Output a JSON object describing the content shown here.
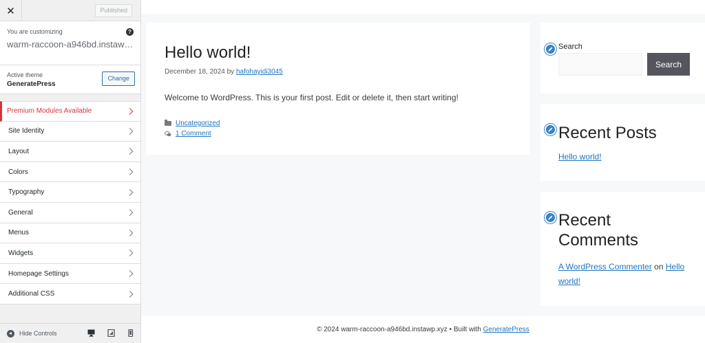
{
  "customizer": {
    "close_icon": "close-icon",
    "publish_label": "Published",
    "customizing_label": "You are customizing",
    "site_name": "warm-raccoon-a946bd.instawp.xyz",
    "active_theme_label": "Active theme",
    "theme_name": "GeneratePress",
    "change_label": "Change",
    "menu": [
      {
        "label": "Premium Modules Available"
      },
      {
        "label": "Site Identity"
      },
      {
        "label": "Layout"
      },
      {
        "label": "Colors"
      },
      {
        "label": "Typography"
      },
      {
        "label": "General"
      },
      {
        "label": "Menus"
      },
      {
        "label": "Widgets"
      },
      {
        "label": "Homepage Settings"
      },
      {
        "label": "Additional CSS"
      }
    ],
    "hide_controls_label": "Hide Controls"
  },
  "post": {
    "title": "Hello world!",
    "date": "December 18, 2024",
    "by": "by",
    "author": "hafohayidi3045",
    "content": "Welcome to WordPress. This is your first post. Edit or delete it, then start writing!",
    "category": "Uncategorized",
    "comments": "1 Comment"
  },
  "sidebar_widgets": {
    "search_label": "Search",
    "search_button": "Search",
    "recent_posts_title": "Recent Posts",
    "recent_post_link": "Hello world!",
    "recent_comments_title": "Recent Comments",
    "commenter": "A WordPress Commenter",
    "on": "on",
    "comment_post": "Hello world!"
  },
  "footer": {
    "copyright": "© 2024 warm-raccoon-a946bd.instawp.xyz • Built with",
    "built_with_link": "GeneratePress"
  },
  "colors": {
    "premium_red": "#d63638",
    "link_blue": "#1e73be",
    "edit_shortcut_blue": "#3582c4",
    "search_button_bg": "#55555e"
  }
}
